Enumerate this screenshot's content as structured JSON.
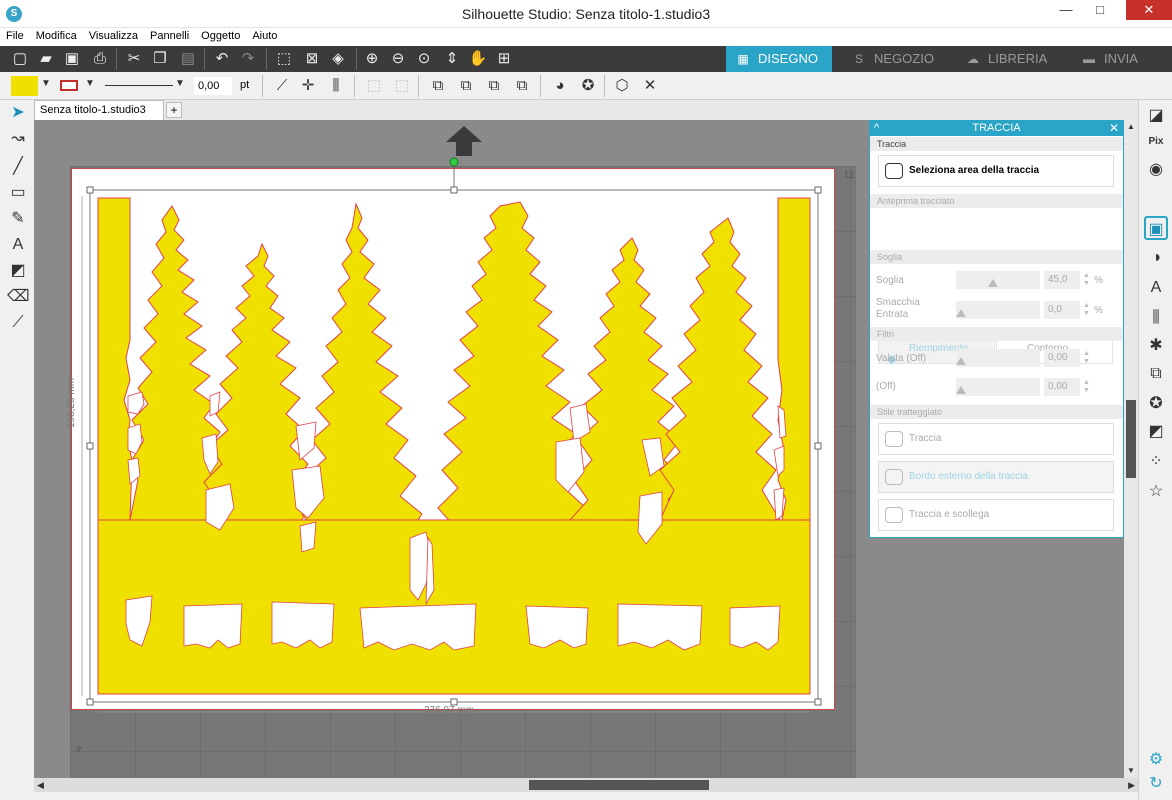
{
  "window": {
    "title": "Silhouette Studio: Senza titolo-1.studio3",
    "logo": "S",
    "controls": {
      "minimize": "—",
      "maximize": "□",
      "close": "✕"
    }
  },
  "menu": [
    "File",
    "Modifica",
    "Visualizza",
    "Pannelli",
    "Oggetto",
    "Aiuto"
  ],
  "modes": [
    {
      "label": "DISEGNO",
      "icon": "grid-icon",
      "glyph": "▦"
    },
    {
      "label": "NEGOZIO",
      "icon": "store-icon",
      "glyph": "S"
    },
    {
      "label": "LIBRERIA",
      "icon": "cloud-icon",
      "glyph": "☁"
    },
    {
      "label": "INVIA",
      "icon": "cutter-icon",
      "glyph": "▬"
    }
  ],
  "toolbar2": {
    "line_width": "0,00",
    "unit": "pt",
    "fill_color": "#f0e000",
    "line_color": "#c0302b"
  },
  "document": {
    "tab_label": "Senza titolo-1.studio3",
    "add_tab": "+"
  },
  "canvas": {
    "height_label": "193,26 mm",
    "width_label": "276,97 mm",
    "ruler_top_right": "12",
    "ruler_bottom_left": "9",
    "design_color": "#f0e000",
    "outline_color": "#e0404a"
  },
  "panel": {
    "title": "TRACCIA",
    "chevron": "^",
    "close": "✕",
    "sections": {
      "traccia": "Traccia",
      "anteprima": "Anteprima tracciato",
      "soglia": "Soglia",
      "filtri": "Filtri",
      "stile": "Stile tratteggiato"
    },
    "select_area": "Seleziona area della traccia",
    "fill_label": "Riempimento",
    "outline_label": "Contorno",
    "threshold_label": "Soglia",
    "threshold_value": "45,0",
    "blur_label_1": "Smacchia",
    "blur_label_2": "Entrata",
    "blur_value": "0,0",
    "filter1_label": "Valuta (Off)",
    "filter1_value": "0,00",
    "filter2_label": "(Off)",
    "filter2_value": "0,00",
    "percent": "%",
    "trace_btn": "Traccia",
    "trace_outer_btn": "Bordo esterno della traccia",
    "trace_detach_btn": "Traccia e scollega"
  }
}
